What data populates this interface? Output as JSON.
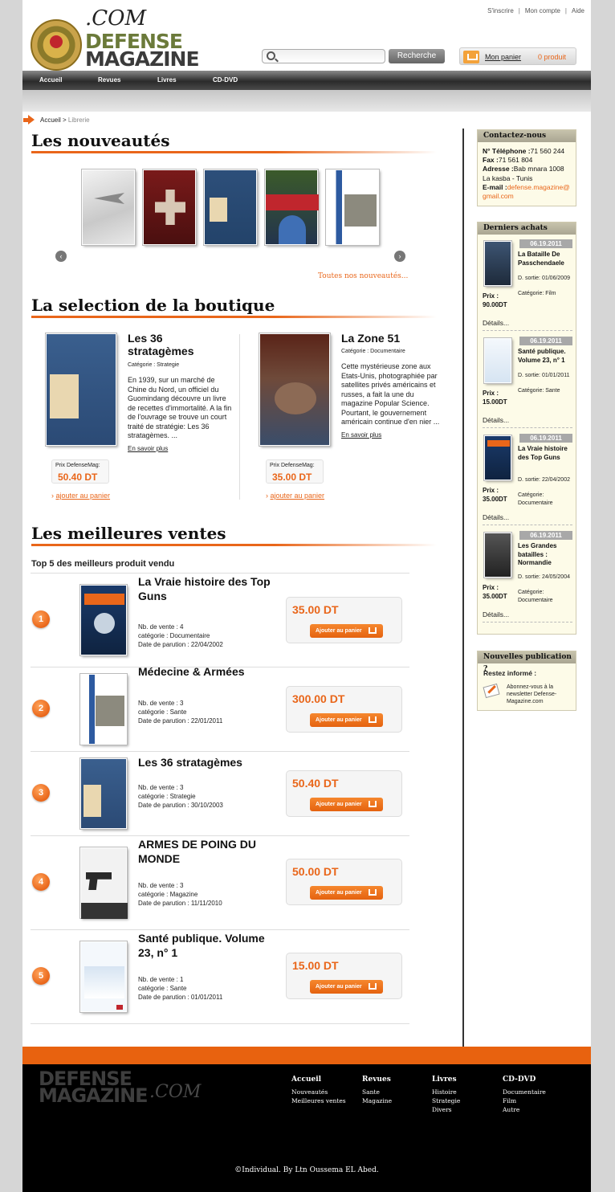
{
  "header": {
    "top_links": [
      "S'inscrire",
      "Mon compte",
      "Aide"
    ],
    "logo_com": ".COM",
    "logo_line1": "DEFENSE",
    "logo_line2": "MAGAZINE",
    "search_placeholder": "",
    "search_button": "Recherche",
    "cart_link": "Mon panier",
    "cart_count": "0 produit"
  },
  "nav": [
    "Accueil",
    "Revues",
    "Livres",
    "CD-DVD"
  ],
  "breadcrumb": {
    "home": "Accueil",
    "sep": " > ",
    "current": "Librerie"
  },
  "nouveautes": {
    "title": "Les nouveautés",
    "all_link": "Toutes nos nouveautés...",
    "prev": "‹",
    "next": "›"
  },
  "selection": {
    "title": "La selection de la boutique",
    "items": [
      {
        "title": "Les 36 stratagèmes",
        "category": "Catégorie : Strategie",
        "desc": "En 1939, sur un marché de Chine du Nord, un officiel du Guomindang découvre un livre de recettes d'immortalité. A la fin de l'ouvrage se trouve un court traité de stratégie: Les 36 stratagèmes. ...",
        "more": "En savoir plus",
        "price_label": "Prix DefenseMag:",
        "price": "50.40 DT",
        "add": "ajouter au panier"
      },
      {
        "title": "La Zone 51",
        "category": "Catégorie : Documentaire",
        "desc": "Cette mystérieuse zone aux Etats-Unis, photographiée par satellites privés américains et russes, a fait la une du magazine Popular Science. Pourtant, le gouvernement américain continue d'en nier ...",
        "more": "En savoir plus",
        "price_label": "Prix DefenseMag:",
        "price": "35.00 DT",
        "add": "ajouter au panier"
      }
    ]
  },
  "best": {
    "title": "Les meilleures ventes",
    "subtitle": "Top 5 des meilleurs produit vendu",
    "add_label": "Ajouter au panier",
    "items": [
      {
        "rank": "1",
        "title": "La Vraie histoire des Top Guns",
        "sales": "Nb. de vente : 4",
        "cat": "catégorie : Documentaire",
        "date": "Date de parution : 22/04/2002",
        "price": "35.00 DT"
      },
      {
        "rank": "2",
        "title": "Médecine & Armées",
        "sales": "Nb. de vente : 3",
        "cat": "catégorie : Sante",
        "date": "Date de parution : 22/01/2011",
        "price": "300.00 DT"
      },
      {
        "rank": "3",
        "title": "Les 36 stratagèmes",
        "sales": "Nb. de vente : 3",
        "cat": "catégorie : Strategie",
        "date": "Date de parution : 30/10/2003",
        "price": "50.40 DT"
      },
      {
        "rank": "4",
        "title": "ARMES DE POING DU MONDE",
        "sales": "Nb. de vente : 3",
        "cat": "catégorie : Magazine",
        "date": "Date de parution : 11/11/2010",
        "price": "50.00 DT"
      },
      {
        "rank": "5",
        "title": "Santé publique. Volume 23, n° 1",
        "sales": "Nb. de vente : 1",
        "cat": "catégorie : Sante",
        "date": "Date de parution : 01/01/2011",
        "price": "15.00 DT"
      }
    ]
  },
  "contact": {
    "title": "Contactez-nous",
    "tel_label": "N° Téléphone :",
    "tel": "71 560 244",
    "fax_label": "Fax :",
    "fax": "71 561 804",
    "addr_label": "Adresse :",
    "addr": "Bab mnara 1008 La kasba - Tunis",
    "email_label": "E-mail :",
    "email": "defense.magazine@gmail.com"
  },
  "achats": {
    "title": "Derniers achats",
    "details": "Détails...",
    "items": [
      {
        "date": "06.19.2011",
        "title": "La Bataille De Passchendaele",
        "sortie": "D. sortie: 01/06/2009",
        "cat": "Catégorie: Film",
        "prix_label": "Prix :",
        "prix": "90.00DT"
      },
      {
        "date": "06.19.2011",
        "title": "Santé publique. Volume 23, n° 1",
        "sortie": "D. sortie: 01/01/2011",
        "cat": "Catégorie: Sante",
        "prix_label": "Prix :",
        "prix": "15.00DT"
      },
      {
        "date": "06.19.2011",
        "title": "La Vraie histoire des Top Guns",
        "sortie": "D. sortie: 22/04/2002",
        "cat": "Catégorie: Documentaire",
        "prix_label": "Prix :",
        "prix": "35.00DT"
      },
      {
        "date": "06.19.2011",
        "title": "Les Grandes batailles : Normandie",
        "sortie": "D. sortie: 24/05/2004",
        "cat": "Catégorie: Documentaire",
        "prix_label": "Prix :",
        "prix": "35.00DT"
      }
    ]
  },
  "newsletter": {
    "title": "Nouvelles publication ?",
    "subtitle": "Restez informé :",
    "text": "Abonnez-vous à la newsletter Defense-Magazine.com"
  },
  "footer": {
    "logo1": "DEFENSE",
    "logo2": "MAGAZINE",
    "com": ".COM",
    "cols": [
      {
        "h": "Accueil",
        "items": [
          "Nouveautés",
          "Meilleures ventes"
        ]
      },
      {
        "h": "Revues",
        "items": [
          "Sante",
          "Magazine"
        ]
      },
      {
        "h": "Livres",
        "items": [
          "Histoire",
          "Strategie",
          "Divers"
        ]
      },
      {
        "h": "CD-DVD",
        "items": [
          "Documentaire",
          "Film",
          "Autre"
        ]
      }
    ],
    "copyright": "©Individual. By Ltn Oussema EL Abed."
  },
  "colors": {
    "accent": "#e9661a",
    "nav": "#2b2b2b",
    "sidebar_bg": "#fdfbe8"
  }
}
